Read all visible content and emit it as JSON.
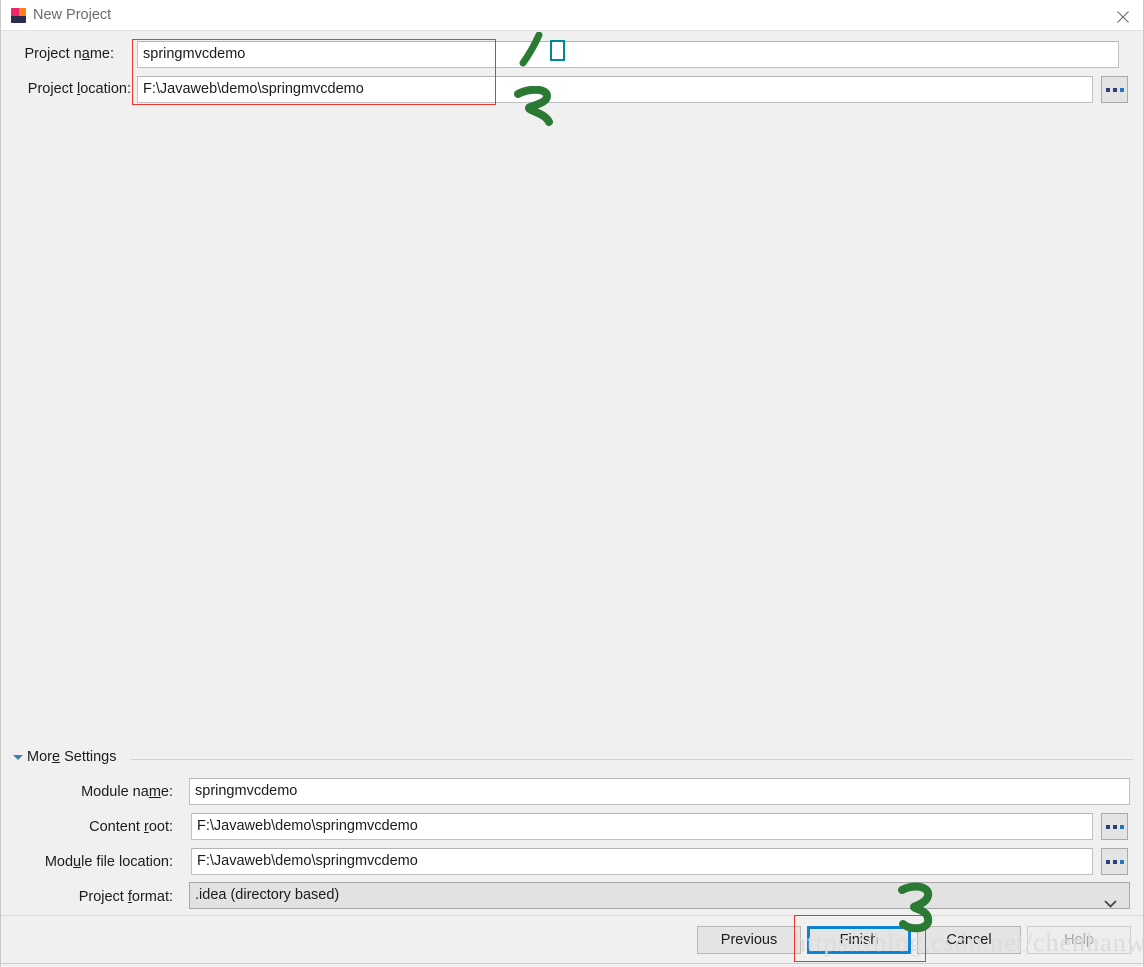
{
  "window": {
    "title": "New Project",
    "icon": "intellij-idea-icon",
    "close_icon": "close-icon"
  },
  "top_fields": [
    {
      "label_before": "Project n",
      "label_mnemonic": "a",
      "label_after": "me:",
      "label_full": "Project name:",
      "value": "springmvcdemo",
      "has_browse": false
    },
    {
      "label_before": "Project ",
      "label_mnemonic": "l",
      "label_after": "ocation:",
      "label_full": "Project location:",
      "value": "F:\\Javaweb\\demo\\springmvcdemo",
      "has_browse": true,
      "browse_label": "..."
    }
  ],
  "more_settings": {
    "label_before": "Mor",
    "label_mnemonic": "e",
    "label_after": " Settings",
    "label_full": "More Settings",
    "expanded": true,
    "fields": [
      {
        "label_before": "Module na",
        "label_mnemonic": "m",
        "label_after": "e:",
        "label_full": "Module name:",
        "value": "springmvcdemo",
        "type": "text",
        "has_browse": false
      },
      {
        "label_before": "Content ",
        "label_mnemonic": "r",
        "label_after": "oot:",
        "label_full": "Content root:",
        "value": "F:\\Javaweb\\demo\\springmvcdemo",
        "type": "text",
        "has_browse": true,
        "browse_label": "..."
      },
      {
        "label_before": "Mod",
        "label_mnemonic": "u",
        "label_after": "le file location:",
        "label_full": "Module file location:",
        "value": "F:\\Javaweb\\demo\\springmvcdemo",
        "type": "text",
        "has_browse": true,
        "browse_label": "..."
      },
      {
        "label_before": "Project ",
        "label_mnemonic": "f",
        "label_after": "ormat:",
        "label_full": "Project format:",
        "value": ".idea (directory based)",
        "type": "combo",
        "has_browse": false
      }
    ]
  },
  "buttons": {
    "previous": "Previous",
    "finish": "Finish",
    "cancel": "Cancel",
    "help": "Help"
  },
  "annotations": {
    "step1": "1",
    "step2": "2",
    "step3": "3",
    "colors": {
      "red_box": "#f0352c",
      "teal_box": "#00888f",
      "green_pen": "#2a7a34",
      "focus_blue": "#0b83d9"
    }
  },
  "watermark": "https://blog.csdn.net/chenhanwa"
}
